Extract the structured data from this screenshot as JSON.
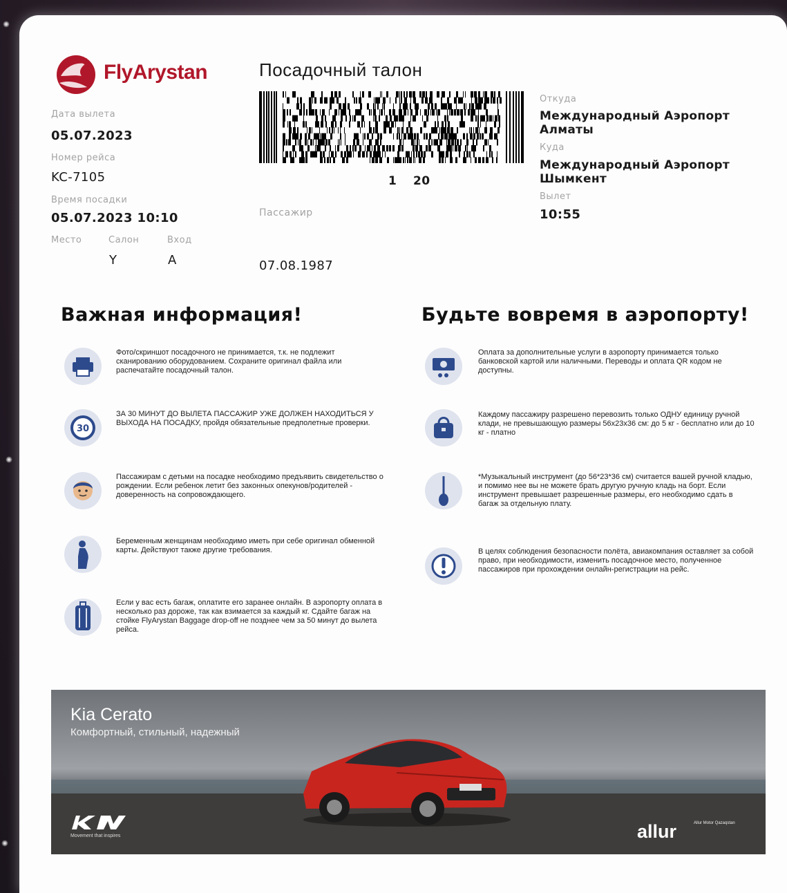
{
  "brand": {
    "name": "FlyArystan",
    "color": "#b1172a"
  },
  "ticket": {
    "title": "Посадочный талон",
    "departure_date_label": "Дата вылета",
    "departure_date": "05.07.2023",
    "flight_label": "Номер рейса",
    "flight": "KC-7105",
    "boarding_label": "Время посадки",
    "boarding_time": "05.07.2023 10:10",
    "seat_label": "Место",
    "cabin_label": "Салон",
    "cabin": "Y",
    "gate_label": "Вход",
    "gate": "A",
    "barcode_number_1": "1",
    "barcode_number_2": "20",
    "passenger_label": "Пассажир",
    "birth_date": "07.08.1987",
    "from_label": "Откуда",
    "from": "Международный Аэропорт Алматы",
    "to_label": "Куда",
    "to": "Международный Аэропорт Шымкент",
    "departure_label": "Вылет",
    "departure_time": "10:55"
  },
  "important": {
    "heading": "Важная информация!",
    "items": [
      {
        "icon": "printer-icon",
        "text": "Фото/скриншот посадочного не принимается, т.к. не подлежит сканированию оборудованием. Сохраните оригинал файла или распечатайте посадочный талон."
      },
      {
        "icon": "clock-30-icon",
        "text": "ЗА 30 МИНУТ ДО ВЫЛЕТА ПАССАЖИР УЖЕ ДОЛЖЕН НАХОДИТЬСЯ У ВЫХОДА НА ПОСАДКУ, пройдя обязательные предполетные проверки."
      },
      {
        "icon": "child-icon",
        "text": "Пассажирам с детьми на посадке необходимо предъявить свидетельство о рождении. Если ребенок летит без законных опекунов/родителей - доверенность на сопровождающего."
      },
      {
        "icon": "pregnant-woman-icon",
        "text": "Беременным женщинам необходимо иметь при себе оригинал обменной карты. Действуют также другие требования."
      },
      {
        "icon": "suitcase-icon",
        "text": "Если у вас есть багаж, оплатите его заранее онлайн. В аэропорту оплата в несколько раз дороже, так как взимается за каждый кг. Сдайте багаж на стойке FlyArystan Baggage drop-off не позднее чем за 50 минут до вылета рейса."
      }
    ]
  },
  "on_time": {
    "heading": "Будьте вовремя в аэропорту!",
    "items": [
      {
        "icon": "payment-icon",
        "text": "Оплата за дополнительные услуги в аэропорту принимается только банковской картой или наличными. Переводы и оплата QR кодом не доступны."
      },
      {
        "icon": "handbag-icon",
        "text": "Каждому пассажиру разрешено перевозить только ОДНУ единицу ручной клади, не превышающую размеры 56x23x36 см: до 5 кг - бесплатно или до 10 кг - платно"
      },
      {
        "icon": "guitar-icon",
        "text": "*Музыкальный инструмент (до 56*23*36 см) считается вашей ручной кладью, и помимо нее вы не можете брать другую ручную кладь на борт. Если инструмент превышает разрешенные размеры, его необходимо сдать в багаж за отдельную плату."
      },
      {
        "icon": "exclamation-icon",
        "text": "В целях соблюдения безопасности полёта, авиакомпания оставляет за собой право, при необходимости, изменить посадочное место, полученное пассажиров при прохождении онлайн-регистрации на рейс."
      }
    ]
  },
  "ad": {
    "title": "Kia Cerato",
    "subtitle": "Комфортный, стильный, надежный",
    "logo": "KIA",
    "logo_tagline": "Movement that inspires",
    "dealer": "allur",
    "dealer_note": "Allur Motor Qazaqstan"
  }
}
